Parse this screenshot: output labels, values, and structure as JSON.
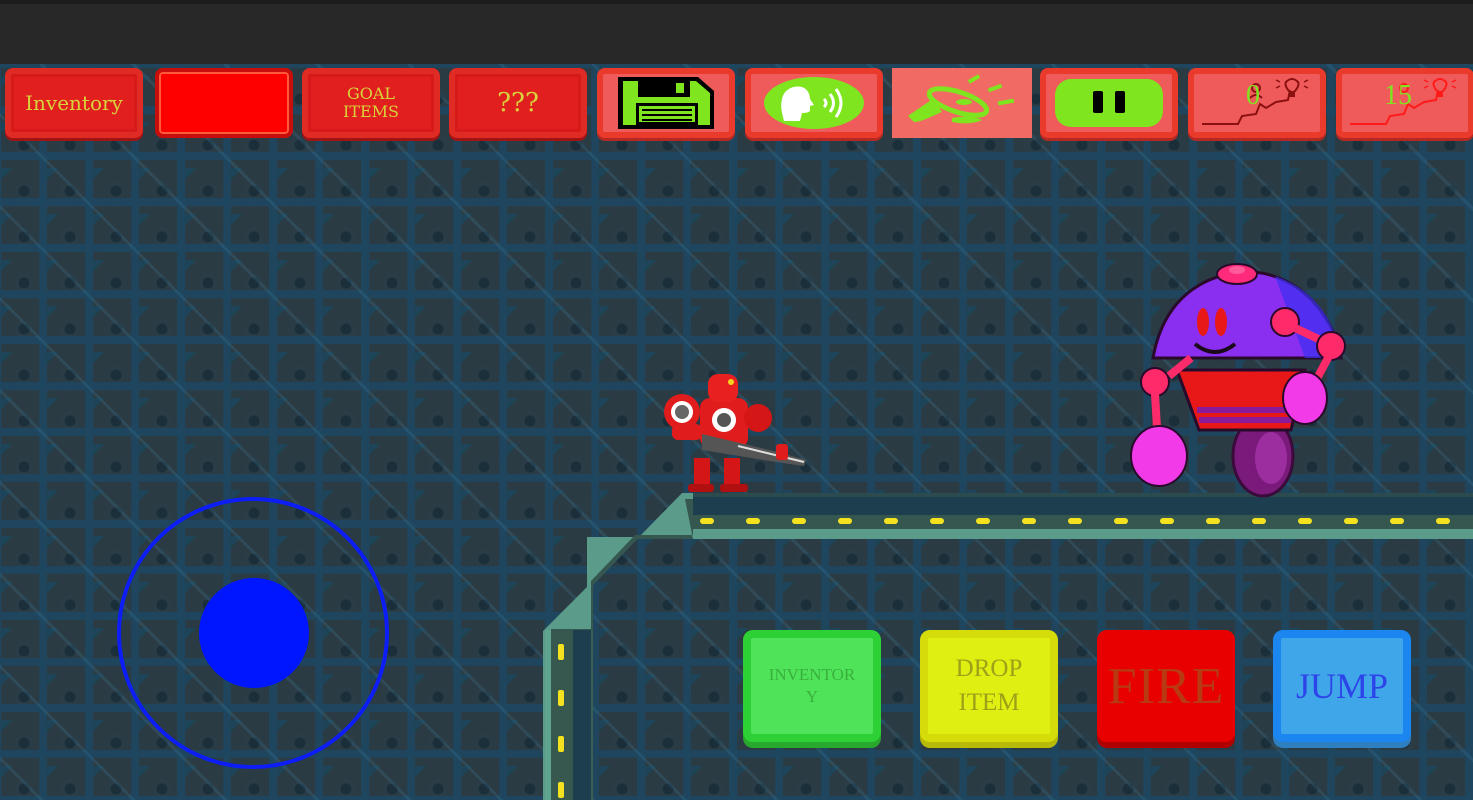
{
  "hud": {
    "inventory_label": "Inventory",
    "empty_slot_label": "",
    "goal_items_label_line1": "GOAL",
    "goal_items_label_line2": "ITEMS",
    "mystery_label": "???",
    "save_icon": "floppy-disk-icon",
    "voice_icon": "speaking-head-icon",
    "sound_icon": "megaphone-icon",
    "pause_icon": "pause-icon",
    "progress_counter_1": "0",
    "progress_counter_2": "15",
    "progress_icon": "path-to-idea-icon"
  },
  "controls": {
    "joystick": "virtual-joystick",
    "inventory_line1": "INVENTOR",
    "inventory_line2": "Y",
    "drop_item_line1": "DROP",
    "drop_item_line2": "ITEM",
    "fire_label": "FIRE",
    "jump_label": "JUMP"
  },
  "scene": {
    "player": "red-armored-robot-with-gun",
    "enemy": "purple-unicycle-robot"
  },
  "colors": {
    "hud_red": "#e21f1f",
    "hud_salmon": "#ef5b5b",
    "hud_text_yellow": "#d8d33a",
    "icon_green": "#7fe51f",
    "joystick_blue": "#0016ff",
    "btn_green": "#4fe35a",
    "btn_yellow": "#e0ef12",
    "btn_red": "#e80000",
    "btn_blue": "#3fa6ea"
  }
}
